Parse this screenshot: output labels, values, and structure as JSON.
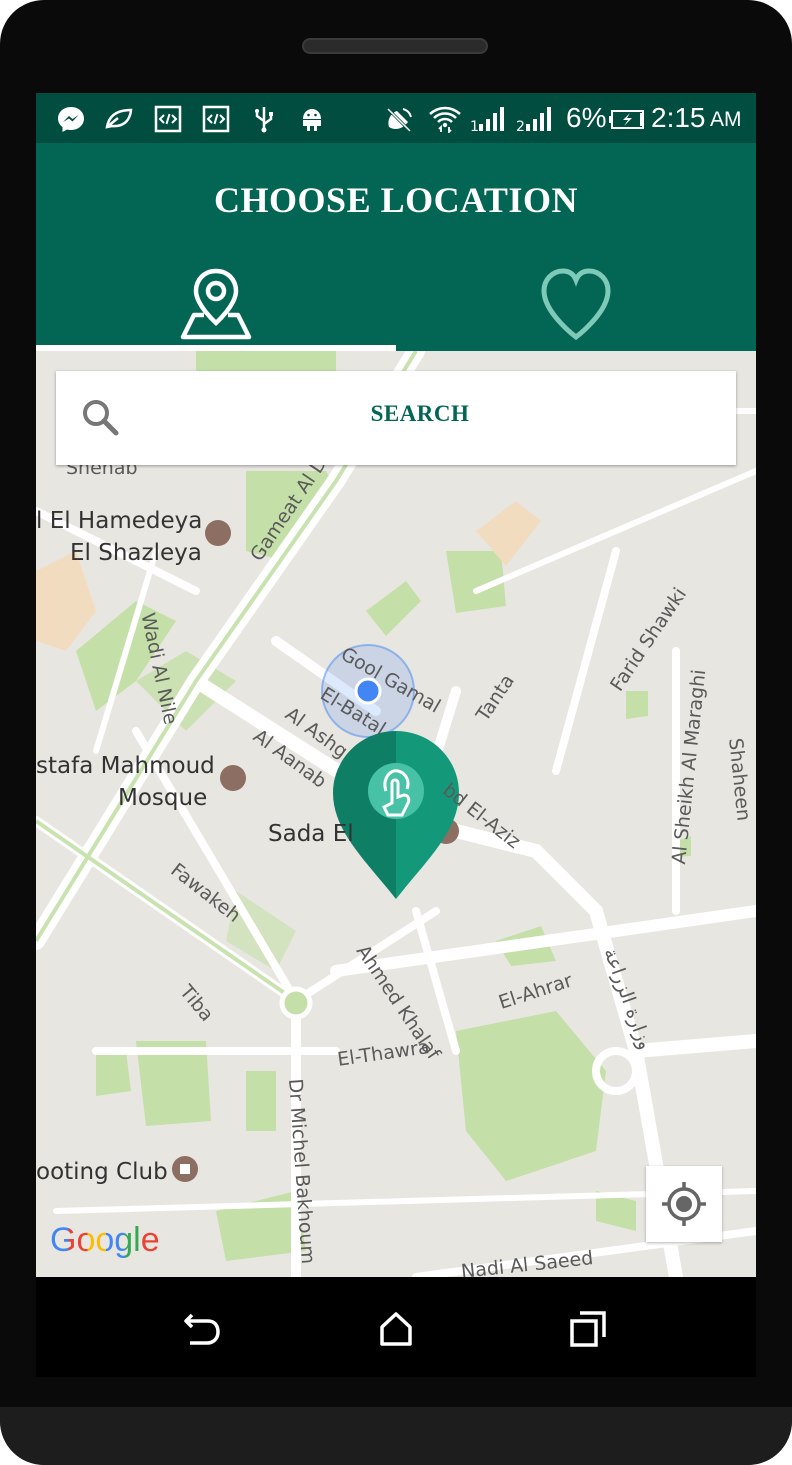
{
  "status_bar": {
    "battery_percent": "6%",
    "time": "2:15",
    "ampm": "AM",
    "icons": [
      "messenger-icon",
      "chrome-leaf-icon",
      "code-icon",
      "code-icon",
      "usb-icon",
      "android-icon",
      "no-sound-icon",
      "wifi-icon",
      "signal-1-icon",
      "signal-2-icon",
      "battery-charging-icon"
    ]
  },
  "header": {
    "title": "CHOOSE LOCATION",
    "tabs": [
      {
        "icon": "map-pin-icon",
        "selected": true
      },
      {
        "icon": "heart-icon",
        "selected": false
      }
    ]
  },
  "search": {
    "label": "SEARCH",
    "icon": "search-icon"
  },
  "map": {
    "poi_labels": [
      "l El Hamedeya",
      "El Shazleya",
      "stafa Mahmoud",
      "Mosque",
      "Sada El",
      "ooting Club"
    ],
    "street_labels": [
      "Gameat Al Dewal Al A",
      "Wadi Al Nile",
      "Gool Gamal",
      "El-Batal",
      "Tanta",
      "Farid Shawki",
      "Al Ashg",
      "Al Aanab",
      "bd El-Aziz",
      "Al Sheikh Al Maraghi",
      "Shaheen",
      "Fawakeh",
      "Ahmed Khalaf",
      "El-Ahrar",
      "Tiba",
      "El-Thawra",
      "Dr Michel Bakhoum",
      "Nadi Al Saeed",
      "Shehab",
      "وزارة الزراعة"
    ],
    "attribution": "Google",
    "colors": {
      "pin": "#13997a",
      "pin_dark": "#0e7f65",
      "current_location": "#4285f4",
      "park": "#c4e0a8",
      "road": "#ffffff"
    }
  },
  "controls": {
    "my_location_icon": "crosshair-icon"
  },
  "navbar": {
    "buttons": [
      "back-icon",
      "home-icon",
      "recents-icon"
    ]
  }
}
